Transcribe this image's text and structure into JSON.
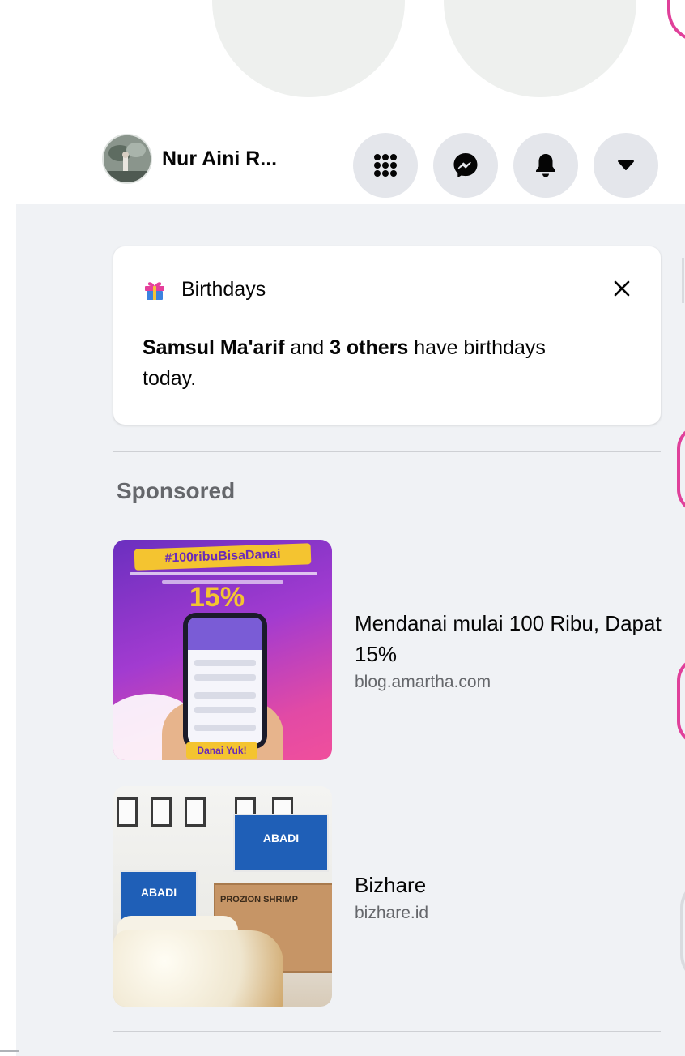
{
  "header": {
    "profile_name": "Nur Aini R...",
    "icons": [
      "menu-grid-icon",
      "messenger-icon",
      "notification-bell-icon",
      "account-caret-icon"
    ],
    "button_color": "#e4e6eb"
  },
  "birthday": {
    "title": "Birthdays",
    "name": "Samsul Ma'arif",
    "connector": " and ",
    "others": "3 others",
    "suffix": " have birthdays today."
  },
  "sponsored": {
    "title": "Sponsored",
    "ads": [
      {
        "title": "Mendanai mulai 100 Ribu, Dapat 15%",
        "domain": "blog.amartha.com",
        "thumb_text": {
          "hashtag": "#100ribuBisaDanai",
          "percent": "15%",
          "cta": "Danai Yuk!"
        }
      },
      {
        "title": "Bizhare",
        "domain": "bizhare.id",
        "thumb_text": {
          "sign": "ABADI",
          "box": "PROZION SHRIMP"
        }
      }
    ]
  },
  "colors": {
    "panel_bg": "#f0f2f5",
    "secondary_text": "#65676b",
    "accent_pink": "#e0409a"
  }
}
